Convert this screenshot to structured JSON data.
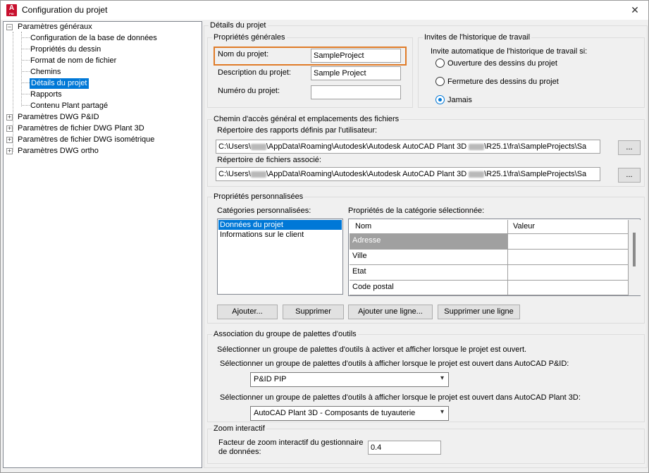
{
  "window": {
    "title": "Configuration du projet",
    "app_icon_letter": "A",
    "app_icon_sub": "PID",
    "close_glyph": "✕"
  },
  "tree": {
    "root1": "Paramètres généraux",
    "root1_children": [
      "Configuration de la base de données",
      "Propriétés du dessin",
      "Format de nom de fichier",
      "Chemins",
      "Détails du projet",
      "Rapports",
      "Contenu Plant partagé"
    ],
    "roots": [
      "Paramètres DWG P&ID",
      "Paramètres de fichier DWG Plant 3D",
      "Paramètres de fichier DWG isométrique",
      "Paramètres DWG ortho"
    ],
    "expand_minus": "−",
    "expand_plus": "+"
  },
  "details": {
    "section_title": "Détails du projet",
    "general": {
      "legend": "Propriétés générales",
      "name_label": "Nom du projet:",
      "name_value": "SampleProject",
      "desc_label": "Description du projet:",
      "desc_value": "Sample Project",
      "number_label": "Numéro du projet:",
      "number_value": ""
    },
    "history": {
      "legend": "Invites de l'historique de travail",
      "prompt": "Invite automatique de l'historique de travail si:",
      "options": [
        "Ouverture des dessins du projet",
        "Fermeture des dessins du projet",
        "Jamais"
      ],
      "selected": "Jamais"
    },
    "paths": {
      "legend": "Chemin d'accès général et emplacements des fichiers",
      "reports_label": "Répertoire des rapports définis par l'utilisateur:",
      "reports_prefix": "C:\\Users\\",
      "reports_suffix": "\\AppData\\Roaming\\Autodesk\\Autodesk AutoCAD Plant 3D",
      "reports_tail": "\\R25.1\\fra\\SampleProjects\\Sa",
      "assoc_label": "Répertoire de fichiers associé:",
      "assoc_prefix": "C:\\Users\\",
      "assoc_suffix": "\\AppData\\Roaming\\Autodesk\\Autodesk AutoCAD Plant 3D",
      "assoc_tail": "\\R25.1\\fra\\SampleProjects\\Sa",
      "browse_label": "..."
    },
    "custom": {
      "legend": "Propriétés personnalisées",
      "categories_label": "Catégories personnalisées:",
      "categories": [
        "Données du projet",
        "Informations sur le client"
      ],
      "selected_category": "Données du projet",
      "props_label": "Propriétés de la catégorie sélectionnée:",
      "columns": [
        "Nom",
        "Valeur"
      ],
      "rows": [
        {
          "name": "Adresse",
          "value": ""
        },
        {
          "name": "Ville",
          "value": ""
        },
        {
          "name": "Etat",
          "value": ""
        },
        {
          "name": "Code postal",
          "value": ""
        }
      ],
      "buttons": [
        "Ajouter...",
        "Supprimer",
        "Ajouter une ligne...",
        "Supprimer une ligne"
      ]
    },
    "palettes": {
      "legend": "Association du groupe de palettes d'outils",
      "intro": "Sélectionner un groupe de palettes d'outils à activer et afficher lorsque le projet est ouvert.",
      "pid_label": "Sélectionner un groupe de palettes d'outils à afficher lorsque le projet est ouvert dans AutoCAD P&ID:",
      "pid_value": "P&ID PIP",
      "plant_label": "Sélectionner un groupe de palettes d'outils à afficher lorsque le projet est ouvert dans AutoCAD Plant 3D:",
      "plant_value": "AutoCAD Plant 3D - Composants de tuyauterie",
      "arrow": "▾"
    },
    "zoom": {
      "legend": "Zoom interactif",
      "label_line1": "Facteur de zoom interactif du gestionnaire",
      "label_line2": "de données:",
      "value": "0.4"
    }
  },
  "colors": {
    "selection": "#0078d7",
    "highlight": "#e07b28",
    "row_selected_bg": "#a0a0a0"
  }
}
